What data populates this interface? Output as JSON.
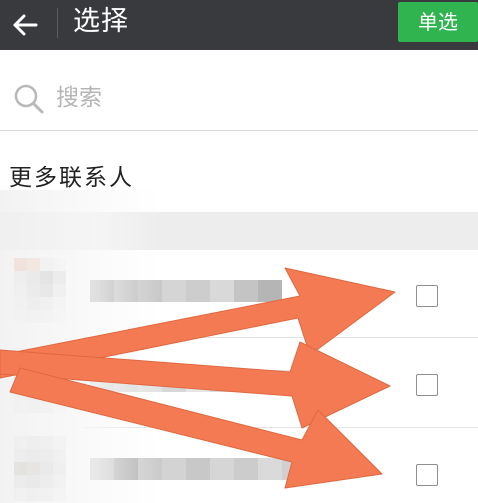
{
  "header": {
    "title": "选择",
    "back_icon": "arrow-left-icon",
    "single_select_label": "单选",
    "bar_color": "#393a3e",
    "button_color": "#2fb450"
  },
  "search": {
    "placeholder": "搜索",
    "icon": "search-icon"
  },
  "section": {
    "title": "更多联系人"
  },
  "contacts": [
    {
      "name": "",
      "checked": false
    },
    {
      "name": "",
      "checked": false
    },
    {
      "name": "",
      "checked": false
    }
  ],
  "annotation": {
    "arrow_color": "#f37a52",
    "arrow_targets": [
      "checkbox-1",
      "checkbox-2",
      "checkbox-3"
    ]
  }
}
